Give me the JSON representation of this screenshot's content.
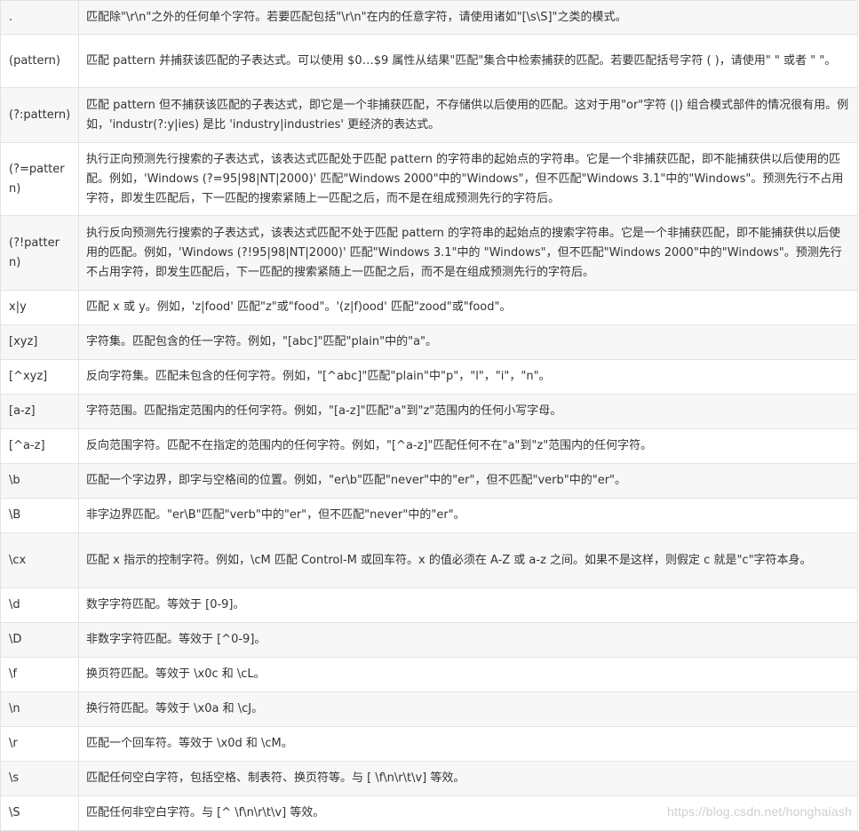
{
  "rows": [
    {
      "syntax": ".",
      "description": "匹配除\"\\r\\n\"之外的任何单个字符。若要匹配包括\"\\r\\n\"在内的任意字符，请使用诸如\"[\\s\\S]\"之类的模式。"
    },
    {
      "syntax": "(pattern)",
      "description": "匹配 pattern 并捕获该匹配的子表达式。可以使用 $0…$9 属性从结果\"匹配\"集合中检索捕获的匹配。若要匹配括号字符 ( )，请使用\" \" 或者 \" \"。"
    },
    {
      "syntax": "(?:pattern)",
      "description": "匹配 pattern 但不捕获该匹配的子表达式，即它是一个非捕获匹配，不存储供以后使用的匹配。这对于用\"or\"字符 (|) 组合模式部件的情况很有用。例如，'industr(?:y|ies) 是比 'industry|industries' 更经济的表达式。"
    },
    {
      "syntax": "(?=pattern)",
      "description": "执行正向预测先行搜索的子表达式，该表达式匹配处于匹配 pattern 的字符串的起始点的字符串。它是一个非捕获匹配，即不能捕获供以后使用的匹配。例如，'Windows (?=95|98|NT|2000)' 匹配\"Windows 2000\"中的\"Windows\"，但不匹配\"Windows 3.1\"中的\"Windows\"。预测先行不占用字符，即发生匹配后，下一匹配的搜索紧随上一匹配之后，而不是在组成预测先行的字符后。"
    },
    {
      "syntax": "(?!pattern)",
      "description": "执行反向预测先行搜索的子表达式，该表达式匹配不处于匹配 pattern 的字符串的起始点的搜索字符串。它是一个非捕获匹配，即不能捕获供以后使用的匹配。例如，'Windows (?!95|98|NT|2000)' 匹配\"Windows 3.1\"中的 \"Windows\"，但不匹配\"Windows 2000\"中的\"Windows\"。预测先行不占用字符，即发生匹配后，下一匹配的搜索紧随上一匹配之后，而不是在组成预测先行的字符后。"
    },
    {
      "syntax": "x|y",
      "description": "匹配 x 或 y。例如，'z|food' 匹配\"z\"或\"food\"。'(z|f)ood' 匹配\"zood\"或\"food\"。"
    },
    {
      "syntax": "[xyz]",
      "description": "字符集。匹配包含的任一字符。例如，\"[abc]\"匹配\"plain\"中的\"a\"。"
    },
    {
      "syntax": "[^xyz]",
      "description": "反向字符集。匹配未包含的任何字符。例如，\"[^abc]\"匹配\"plain\"中\"p\"，\"l\"，\"i\"，\"n\"。"
    },
    {
      "syntax": "[a-z]",
      "description": "字符范围。匹配指定范围内的任何字符。例如，\"[a-z]\"匹配\"a\"到\"z\"范围内的任何小写字母。"
    },
    {
      "syntax": "[^a-z]",
      "description": "反向范围字符。匹配不在指定的范围内的任何字符。例如，\"[^a-z]\"匹配任何不在\"a\"到\"z\"范围内的任何字符。"
    },
    {
      "syntax": "\\b",
      "description": "匹配一个字边界，即字与空格间的位置。例如，\"er\\b\"匹配\"never\"中的\"er\"，但不匹配\"verb\"中的\"er\"。"
    },
    {
      "syntax": "\\B",
      "description": "非字边界匹配。\"er\\B\"匹配\"verb\"中的\"er\"，但不匹配\"never\"中的\"er\"。"
    },
    {
      "syntax": "\\cx",
      "description": "匹配 x 指示的控制字符。例如，\\cM 匹配 Control-M 或回车符。x 的值必须在 A-Z 或 a-z 之间。如果不是这样，则假定 c 就是\"c\"字符本身。"
    },
    {
      "syntax": "\\d",
      "description": "数字字符匹配。等效于 [0-9]。"
    },
    {
      "syntax": "\\D",
      "description": "非数字字符匹配。等效于 [^0-9]。"
    },
    {
      "syntax": "\\f",
      "description": "换页符匹配。等效于 \\x0c 和 \\cL。"
    },
    {
      "syntax": "\\n",
      "description": "换行符匹配。等效于 \\x0a 和 \\cJ。"
    },
    {
      "syntax": "\\r",
      "description": "匹配一个回车符。等效于 \\x0d 和 \\cM。"
    },
    {
      "syntax": "\\s",
      "description": "匹配任何空白字符，包括空格、制表符、换页符等。与 [ \\f\\n\\r\\t\\v] 等效。"
    },
    {
      "syntax": "\\S",
      "description": "匹配任何非空白字符。与 [^ \\f\\n\\r\\t\\v] 等效。"
    }
  ],
  "watermark": "https://blog.csdn.net/honghaiash"
}
